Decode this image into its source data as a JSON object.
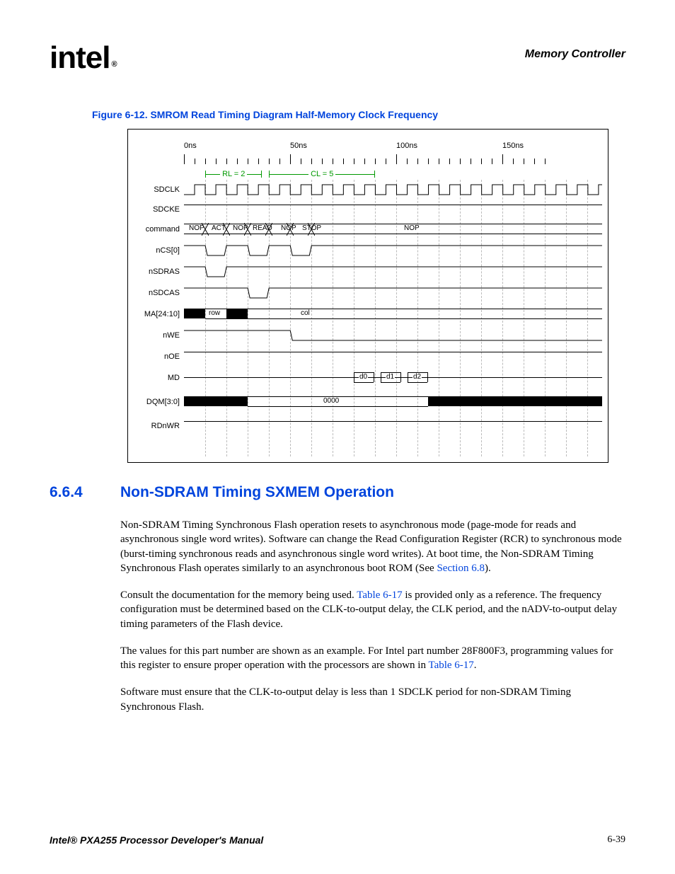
{
  "header": {
    "logo_text": "intel",
    "reg": "®",
    "chapter": "Memory Controller"
  },
  "figure": {
    "caption": "Figure 6-12. SMROM Read Timing Diagram Half-Memory Clock Frequency",
    "time_markers": [
      "0ns",
      "50ns",
      "100ns",
      "150ns"
    ],
    "annotations": {
      "rl": "RL = 2",
      "cl": "CL = 5"
    },
    "signals": {
      "sdclk": "SDCLK",
      "sdcke": "SDCKE",
      "command": "command",
      "ncs0": "nCS[0]",
      "nsdras": "nSDRAS",
      "nsdcas": "nSDCAS",
      "ma": "MA[24:10]",
      "nwe": "nWE",
      "noe": "nOE",
      "md": "MD",
      "dqm": "DQM[3:0]",
      "rdnwr": "RDnWR"
    },
    "command_states": [
      "NOP",
      "ACT",
      "NOP",
      "READ",
      "NOP",
      "STOP",
      "NOP"
    ],
    "ma_states": [
      "row",
      "col"
    ],
    "md_states": [
      "d0",
      "d1",
      "d2"
    ],
    "dqm_value": "0000"
  },
  "section": {
    "num": "6.6.4",
    "title": "Non-SDRAM Timing SXMEM Operation",
    "p1_a": "Non-SDRAM Timing Synchronous Flash operation resets to asynchronous mode (page-mode for reads and asynchronous single word writes). Software can change the Read Configuration Register (RCR) to synchronous mode (burst-timing synchronous reads and asynchronous single word writes). At boot time, the Non-SDRAM Timing Synchronous Flash operates similarly to an asynchronous boot ROM (See ",
    "p1_link": "Section 6.8",
    "p1_b": ").",
    "p2_a": "Consult the documentation for the memory being used. ",
    "p2_link": "Table 6-17",
    "p2_b": " is provided only as a reference. The frequency configuration must be determined based on the CLK-to-output delay, the CLK period, and the nADV-to-output delay timing parameters of the Flash device.",
    "p3_a": "The values for this part number are shown as an example. For Intel part number 28F800F3, programming values for this register to ensure proper operation with the processors are shown in ",
    "p3_link": "Table 6-17",
    "p3_b": ".",
    "p4": "Software must ensure that the CLK-to-output delay is less than 1 SDCLK period for non-SDRAM Timing Synchronous Flash."
  },
  "footer": {
    "title": "Intel® PXA255 Processor Developer's Manual",
    "page": "6-39"
  },
  "chart_data": {
    "type": "timing-diagram",
    "time_axis_ns": [
      0,
      50,
      100,
      150
    ],
    "clock_period_ns": 10,
    "annotations": [
      {
        "label": "RL = 2",
        "from_ns": 10,
        "to_ns": 30
      },
      {
        "label": "CL = 5",
        "from_ns": 30,
        "to_ns": 80
      }
    ],
    "signals": [
      {
        "name": "SDCLK",
        "type": "clock",
        "period_ns": 10
      },
      {
        "name": "SDCKE",
        "type": "level",
        "value": "high"
      },
      {
        "name": "command",
        "type": "bus",
        "segments": [
          {
            "t": 0,
            "value": "NOP"
          },
          {
            "t": 10,
            "value": "ACT"
          },
          {
            "t": 20,
            "value": "NOP"
          },
          {
            "t": 30,
            "value": "READ"
          },
          {
            "t": 40,
            "value": "NOP"
          },
          {
            "t": 50,
            "value": "STOP"
          },
          {
            "t": 60,
            "value": "NOP"
          }
        ]
      },
      {
        "name": "nCS[0]",
        "type": "level",
        "low_intervals_ns": [
          [
            10,
            20
          ],
          [
            30,
            40
          ],
          [
            50,
            60
          ]
        ]
      },
      {
        "name": "nSDRAS",
        "type": "level",
        "low_intervals_ns": [
          [
            10,
            20
          ]
        ]
      },
      {
        "name": "nSDCAS",
        "type": "level",
        "low_intervals_ns": [
          [
            30,
            40
          ]
        ]
      },
      {
        "name": "MA[24:10]",
        "type": "bus",
        "segments": [
          {
            "t": 10,
            "value": "row"
          },
          {
            "t": 30,
            "value": "col"
          }
        ],
        "invalid_intervals_ns": [
          [
            0,
            10
          ],
          [
            20,
            30
          ]
        ]
      },
      {
        "name": "nWE",
        "type": "level",
        "high_to_low_at_ns": 50
      },
      {
        "name": "nOE",
        "type": "level",
        "value": "high"
      },
      {
        "name": "MD",
        "type": "bus",
        "segments": [
          {
            "t": 80,
            "value": "d0"
          },
          {
            "t": 90,
            "value": "d1"
          },
          {
            "t": 100,
            "value": "d2"
          }
        ]
      },
      {
        "name": "DQM[3:0]",
        "type": "bus",
        "invalid_intervals_ns": [
          [
            0,
            30
          ],
          [
            110,
            170
          ]
        ],
        "valid_value": "0000",
        "valid_interval_ns": [
          30,
          110
        ]
      },
      {
        "name": "RDnWR",
        "type": "level",
        "value": "high"
      }
    ]
  }
}
